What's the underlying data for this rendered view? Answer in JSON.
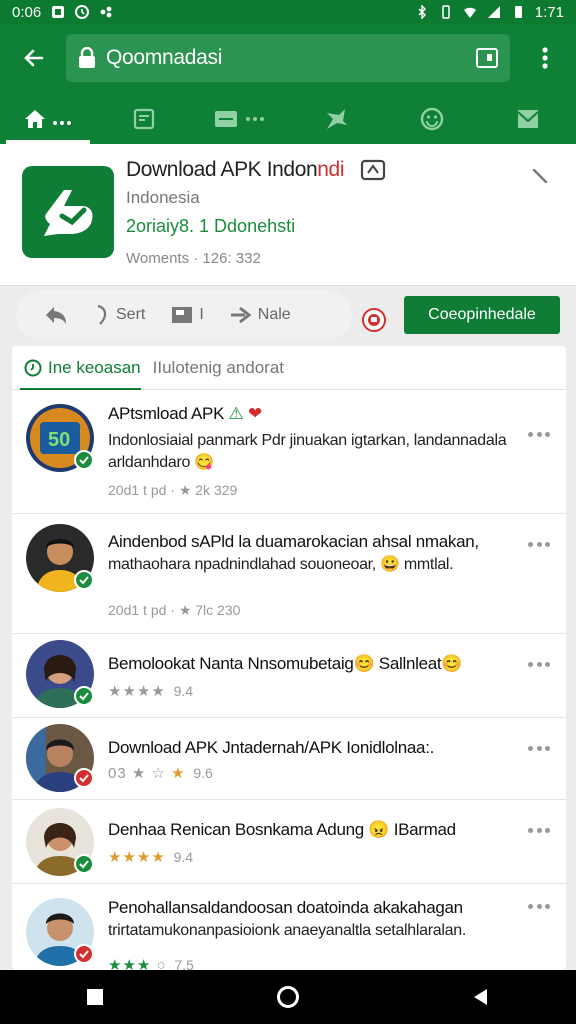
{
  "status": {
    "time": "0:06",
    "right_time": "1:71"
  },
  "browser": {
    "url": "Qoomnadasi",
    "tabs": [
      "home",
      "news",
      "messages",
      "apps",
      "emoji",
      "inbox"
    ]
  },
  "app": {
    "title": "Download APK Indon",
    "title_red": "ndi",
    "subtitle": "Indonesia",
    "stats": "2oriaiy8. ​1 Ddonehsti",
    "meta": "Woments · 126: 332"
  },
  "actions": {
    "back_label": "",
    "sort_label": "Sert",
    "flag_label": "I",
    "share_label": "Nale",
    "cta_label": "Coeopinhedale"
  },
  "subtabs": {
    "active": "Ine keoasan",
    "inactive": "IIulotenig andorat"
  },
  "items": [
    {
      "title": "APtsmload APK",
      "text": "Indonlosiaial panmark Pdr jinuakan igtarkan, landannadala arldanhdaro 😋",
      "meta": "20d1 t pd · ★ 2k 329"
    },
    {
      "title": "Aindenbod sAPld la duamarokacian ahsal nmakan,",
      "text": "mathaohara npadnindlahad souoneoar, 😀 mmtlal.",
      "meta": "20d1 t pd · ★ 7lc 230"
    },
    {
      "title": "Bemolookat Nanta Nnsomubetaig😊 Sallnleat😊",
      "text": "",
      "meta": "9.4"
    },
    {
      "title": "Download APK Jntadernah/APK Ionidlolnaa:.",
      "text": "",
      "meta": "9.6"
    },
    {
      "title": "Denhaa Renican Bosnkama Adung",
      "title_tail": "IBarmad",
      "text": "",
      "meta": "9.4"
    },
    {
      "title": "Penohallansaldandoosan doatoinda akakahagan",
      "text": "trirtatamukonanpasioionk anaeyanaltla setalhlaralan.",
      "meta": "7.5"
    }
  ],
  "colors": {
    "primary": "#0f8136",
    "accent": "#d32f2f",
    "star": "#e09b30"
  }
}
